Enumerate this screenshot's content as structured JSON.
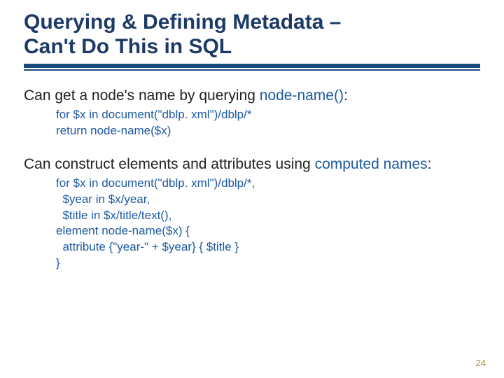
{
  "title_line1": "Querying & Defining Metadata –",
  "title_line2": "Can't Do This in SQL",
  "section1": {
    "intro_prefix": "Can get a node's name by querying ",
    "intro_kw": "node-name()",
    "intro_suffix": ":",
    "code": [
      "for $x in document(\"dblp. xml\")/dblp/*",
      "return node-name($x)"
    ]
  },
  "section2": {
    "intro_prefix": "Can construct elements and attributes using ",
    "intro_kw": "computed names",
    "intro_suffix": ":",
    "code": [
      "for $x in document(\"dblp. xml\")/dblp/*,",
      "  $year in $x/year,",
      "  $title in $x/title/text(),",
      "element node-name($x) {",
      "  attribute {\"year-\" + $year} { $title }",
      "}"
    ]
  },
  "page_number": "24"
}
